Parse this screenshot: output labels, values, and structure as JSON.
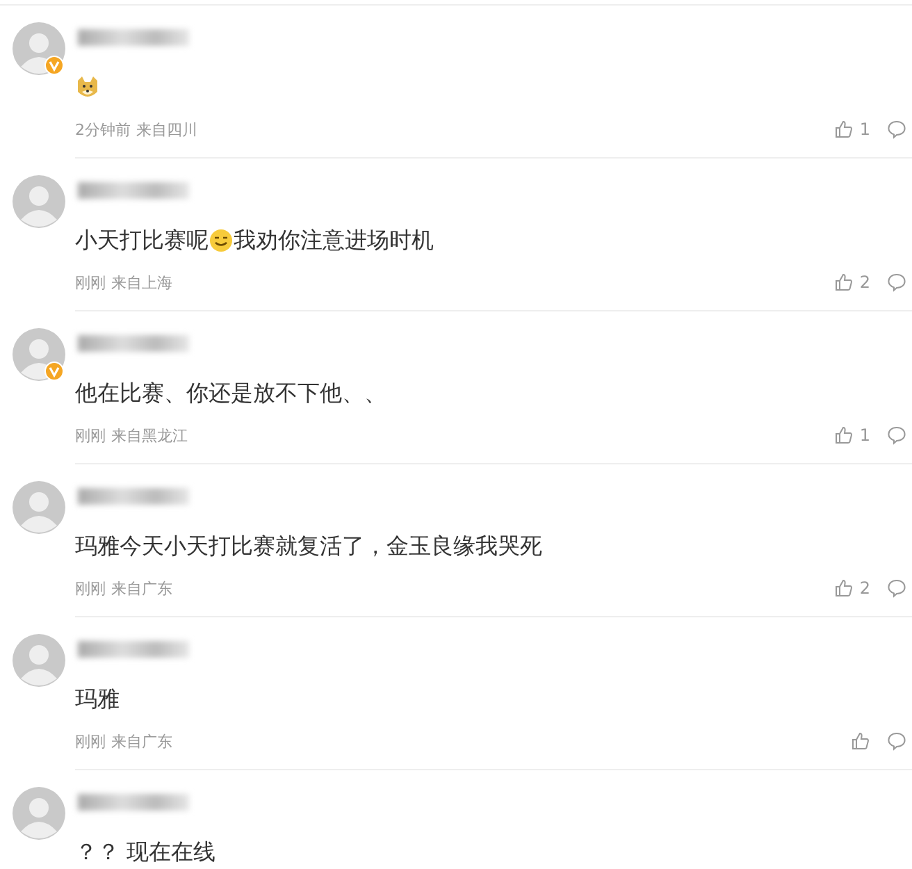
{
  "comments": [
    {
      "verified": true,
      "content": [
        {
          "kind": "doge"
        }
      ],
      "time": "2分钟前",
      "location": "来自四川",
      "likes": "1"
    },
    {
      "verified": false,
      "content": [
        {
          "kind": "text",
          "text": "小天打比赛呢"
        },
        {
          "kind": "grin"
        },
        {
          "kind": "text",
          "text": "我劝你注意进场时机"
        }
      ],
      "time": "刚刚",
      "location": "来自上海",
      "likes": "2"
    },
    {
      "verified": true,
      "content": [
        {
          "kind": "text",
          "text": "他在比赛、你还是放不下他、、"
        }
      ],
      "time": "刚刚",
      "location": "来自黑龙江",
      "likes": "1"
    },
    {
      "verified": false,
      "content": [
        {
          "kind": "text",
          "text": "玛雅今天小天打比赛就复活了，金玉良缘我哭死"
        }
      ],
      "time": "刚刚",
      "location": "来自广东",
      "likes": "2"
    },
    {
      "verified": false,
      "content": [
        {
          "kind": "text",
          "text": "玛雅"
        }
      ],
      "time": "刚刚",
      "location": "来自广东"
    },
    {
      "verified": false,
      "content": [
        {
          "kind": "text",
          "text": "？？ 现在在线"
        }
      ]
    }
  ]
}
